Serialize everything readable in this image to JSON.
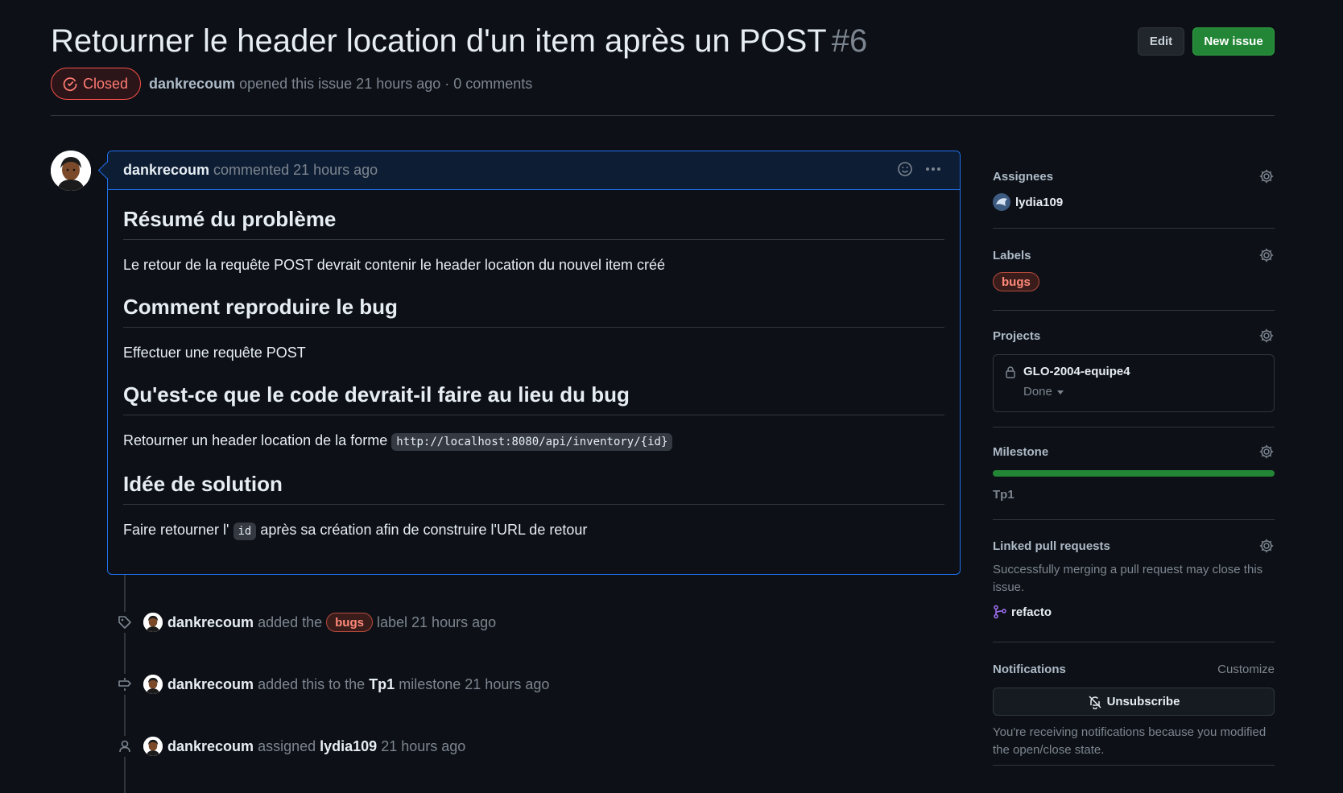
{
  "issue": {
    "title": "Retourner le header location d'un item après un POST",
    "number": "#6",
    "state": "Closed",
    "author": "dankrecoum",
    "opened_text": "opened this issue 21 hours ago · 0 comments"
  },
  "header_buttons": {
    "edit": "Edit",
    "new_issue": "New issue"
  },
  "comment": {
    "author": "dankrecoum",
    "meta": "commented 21 hours ago",
    "sections": [
      {
        "heading": "Résumé du problème",
        "text": "Le retour de la requête POST devrait contenir le header location du nouvel item créé"
      },
      {
        "heading": "Comment reproduire le bug",
        "text": "Effectuer une requête POST"
      },
      {
        "heading": "Qu'est-ce que le code devrait-il faire au lieu du bug",
        "text": "Retourner un header location de la forme",
        "code": "http://localhost:8080/api/inventory/{id}"
      },
      {
        "heading": "Idée de solution",
        "text_before": "Faire retourner l'",
        "code": "id",
        "text_after": "après sa création afin de construire l'URL de retour"
      }
    ]
  },
  "timeline": [
    {
      "icon": "tag-icon",
      "author": "dankrecoum",
      "pre": "added the",
      "label": "bugs",
      "post": "label",
      "time": "21 hours ago"
    },
    {
      "icon": "milestone-icon",
      "author": "dankrecoum",
      "pre": "added this to the",
      "strong": "Tp1",
      "post": "milestone",
      "time": "21 hours ago"
    },
    {
      "icon": "person-icon",
      "author": "dankrecoum",
      "pre": "assigned",
      "strong": "lydia109",
      "time": "21 hours ago"
    }
  ],
  "sidebar": {
    "assignees": {
      "title": "Assignees",
      "user": "lydia109"
    },
    "labels": {
      "title": "Labels",
      "label": "bugs"
    },
    "projects": {
      "title": "Projects",
      "name": "GLO-2004-equipe4",
      "status": "Done"
    },
    "milestone": {
      "title": "Milestone",
      "name": "Tp1",
      "progress_percent": 100
    },
    "linked_prs": {
      "title": "Linked pull requests",
      "help": "Successfully merging a pull request may close this issue.",
      "branch": "refacto"
    },
    "notifications": {
      "title": "Notifications",
      "customize": "Customize",
      "button": "Unsubscribe",
      "reason": "You're receiving notifications because you modified the open/close state."
    }
  },
  "colors": {
    "background": "#0d1117",
    "accent_blue": "#1f6feb",
    "closed_red": "#f85149",
    "green": "#238636"
  }
}
